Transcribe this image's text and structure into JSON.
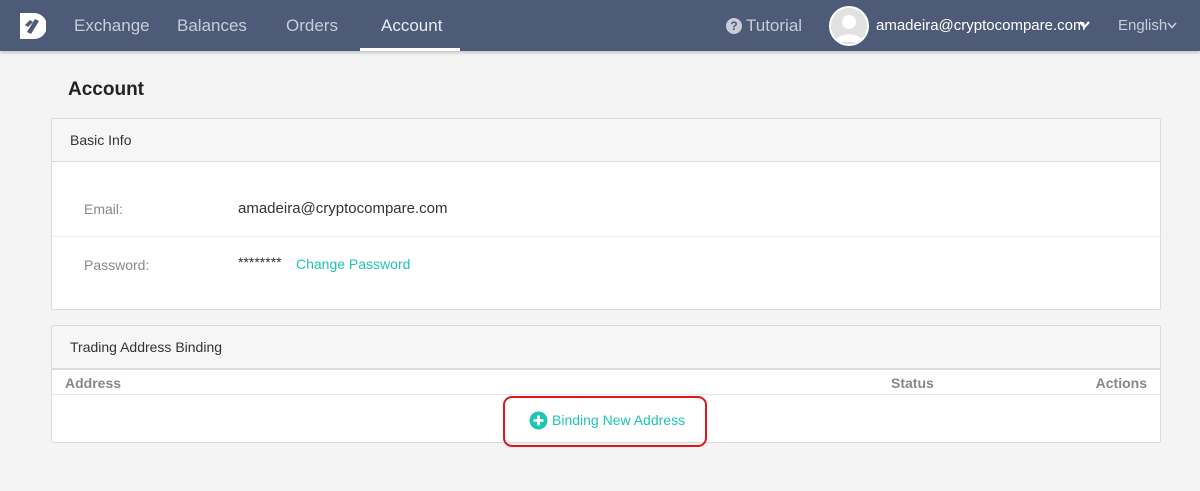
{
  "nav": {
    "items": [
      {
        "label": "Exchange"
      },
      {
        "label": "Balances"
      },
      {
        "label": "Orders"
      },
      {
        "label": "Account"
      }
    ],
    "active": "Account",
    "tutorial_label": "Tutorial",
    "user_email": "amadeira@cryptocompare.com",
    "language": "English"
  },
  "page": {
    "title": "Account"
  },
  "basic_info": {
    "title": "Basic Info",
    "email_label": "Email:",
    "email_value": "amadeira@cryptocompare.com",
    "password_label": "Password:",
    "password_value": "********",
    "change_password_label": "Change Password"
  },
  "trading": {
    "title": "Trading Address Binding",
    "columns": [
      "Address",
      "Status",
      "Actions"
    ],
    "bind_button_label": "Binding New Address"
  },
  "colors": {
    "nav_bg": "#4d5a78",
    "accent": "#1fc4b4",
    "highlight": "#e0161b"
  },
  "icons": [
    "logo-icon",
    "question-icon",
    "avatar-icon",
    "chevron-down-icon",
    "plus-circle-icon"
  ]
}
